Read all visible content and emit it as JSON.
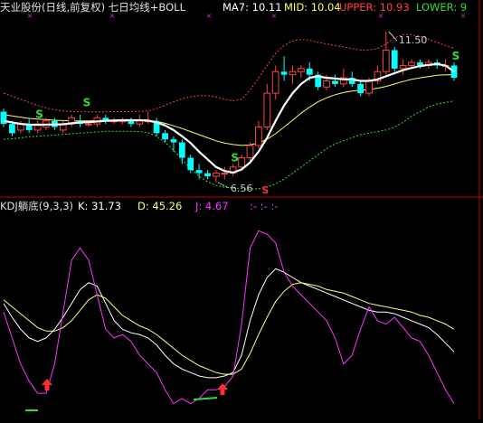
{
  "main_header": {
    "title": "天业股份(日线,前复权) 七日均线+BOLL",
    "ma7": "MA7: 10.11",
    "mid": "MID: 10.04",
    "upper": "UPPER: 10.93",
    "lower": "LOWER: 9"
  },
  "kdj_header": {
    "title": "KDJ躺底(9,3,3)",
    "k": "K: 31.73",
    "d": "D: 45.26",
    "j": "J: 4.67",
    "extra": ":- :- :-"
  },
  "colors": {
    "background": "#000000",
    "title": "#e0e0e0",
    "ma7": "#ffffff",
    "mid": "#ffff66",
    "upper": "#ff4040",
    "lower": "#33dd33",
    "k_line": "#ffffff",
    "d_line": "#ffff80",
    "j_line": "#ff33ff",
    "candle_up": "#ff4040",
    "candle_down": "#00ffff",
    "divider": "#c00000"
  },
  "chart_data": [
    {
      "type": "candlestick",
      "title": "天业股份(日线,前复权) 七日均线+BOLL",
      "price_range": [
        6.3,
        12.0
      ],
      "annotations": {
        "high_label": "11.50",
        "low_label": "6.56",
        "signal_marks": [
          "S",
          "S",
          "S",
          "S"
        ],
        "bottom_signal": "S"
      },
      "candles": [
        [
          8.9,
          8.5,
          9.0,
          8.4
        ],
        [
          8.5,
          8.2,
          8.6,
          8.1
        ],
        [
          8.3,
          8.5,
          8.6,
          8.2
        ],
        [
          8.5,
          8.3,
          8.7,
          8.2
        ],
        [
          8.3,
          8.5,
          8.6,
          8.2
        ],
        [
          8.4,
          8.6,
          8.7,
          8.3
        ],
        [
          8.6,
          8.4,
          8.7,
          8.3
        ],
        [
          8.3,
          8.5,
          8.6,
          8.2
        ],
        [
          8.5,
          8.7,
          8.8,
          8.4
        ],
        [
          8.6,
          8.5,
          8.8,
          8.4
        ],
        [
          8.5,
          8.5,
          8.6,
          8.4
        ],
        [
          8.5,
          8.7,
          8.8,
          8.4
        ],
        [
          8.7,
          8.6,
          8.8,
          8.5
        ],
        [
          8.6,
          8.6,
          8.7,
          8.5
        ],
        [
          8.6,
          8.6,
          8.7,
          8.5
        ],
        [
          8.6,
          8.5,
          8.7,
          8.4
        ],
        [
          8.5,
          8.6,
          8.8,
          8.4
        ],
        [
          8.6,
          8.6,
          8.9,
          8.5
        ],
        [
          8.6,
          8.2,
          8.7,
          8.1
        ],
        [
          8.2,
          8.0,
          8.3,
          7.9
        ],
        [
          8.0,
          7.9,
          8.1,
          7.6
        ],
        [
          7.9,
          7.4,
          8.0,
          7.2
        ],
        [
          7.4,
          7.0,
          7.5,
          6.9
        ],
        [
          7.0,
          6.9,
          7.2,
          6.7
        ],
        [
          6.9,
          6.8,
          7.0,
          6.7
        ],
        [
          6.8,
          6.9,
          7.0,
          6.6
        ],
        [
          6.9,
          6.9,
          7.1,
          6.7
        ],
        [
          6.9,
          7.1,
          7.2,
          6.8
        ],
        [
          7.1,
          7.4,
          7.5,
          7.0
        ],
        [
          7.4,
          7.8,
          7.9,
          7.3
        ],
        [
          7.8,
          8.4,
          8.6,
          7.7
        ],
        [
          8.4,
          9.5,
          9.8,
          8.3
        ],
        [
          9.5,
          10.2,
          10.4,
          9.3
        ],
        [
          10.2,
          10.1,
          10.7,
          9.9
        ],
        [
          10.1,
          10.2,
          10.4,
          9.8
        ],
        [
          10.2,
          10.3,
          10.4,
          10.0
        ],
        [
          10.3,
          10.1,
          10.5,
          9.9
        ],
        [
          10.1,
          9.7,
          10.2,
          9.6
        ],
        [
          9.7,
          9.9,
          10.1,
          9.6
        ],
        [
          9.9,
          9.8,
          10.1,
          9.7
        ],
        [
          9.8,
          10.0,
          10.3,
          9.7
        ],
        [
          10.0,
          9.8,
          10.2,
          9.7
        ],
        [
          9.8,
          9.5,
          9.9,
          9.4
        ],
        [
          9.5,
          9.9,
          10.0,
          9.4
        ],
        [
          9.9,
          10.2,
          10.4,
          9.8
        ],
        [
          10.2,
          10.9,
          11.5,
          10.1
        ],
        [
          10.9,
          10.3,
          11.0,
          10.2
        ],
        [
          10.3,
          10.4,
          10.6,
          10.1
        ],
        [
          10.4,
          10.5,
          10.6,
          10.3
        ],
        [
          10.5,
          10.4,
          10.6,
          10.3
        ],
        [
          10.4,
          10.5,
          10.6,
          10.3
        ],
        [
          10.5,
          10.4,
          10.6,
          10.3
        ],
        [
          10.4,
          10.4,
          10.6,
          10.2
        ],
        [
          10.4,
          10.0,
          10.5,
          9.9
        ]
      ],
      "ma7": [
        8.6,
        8.55,
        8.5,
        8.48,
        8.47,
        8.48,
        8.48,
        8.49,
        8.52,
        8.55,
        8.56,
        8.58,
        8.6,
        8.61,
        8.62,
        8.62,
        8.62,
        8.61,
        8.55,
        8.45,
        8.3,
        8.1,
        7.88,
        7.6,
        7.35,
        7.1,
        6.97,
        6.92,
        7.02,
        7.25,
        7.6,
        8.05,
        8.6,
        9.1,
        9.5,
        9.8,
        10.0,
        10.05,
        10.0,
        9.98,
        9.95,
        9.95,
        9.9,
        9.9,
        9.95,
        10.05,
        10.15,
        10.25,
        10.32,
        10.38,
        10.42,
        10.45,
        10.4,
        10.2
      ],
      "mid": [
        8.8,
        8.76,
        8.72,
        8.68,
        8.66,
        8.64,
        8.62,
        8.61,
        8.6,
        8.6,
        8.6,
        8.61,
        8.62,
        8.63,
        8.63,
        8.63,
        8.63,
        8.62,
        8.58,
        8.52,
        8.44,
        8.35,
        8.25,
        8.15,
        8.05,
        7.95,
        7.88,
        7.83,
        7.8,
        7.82,
        7.88,
        8.0,
        8.18,
        8.4,
        8.62,
        8.85,
        9.05,
        9.22,
        9.35,
        9.45,
        9.52,
        9.57,
        9.6,
        9.62,
        9.66,
        9.72,
        9.8,
        9.88,
        9.95,
        10.0,
        10.04,
        10.08,
        10.1,
        10.1
      ],
      "upper": [
        9.5,
        9.4,
        9.3,
        9.2,
        9.1,
        9.02,
        8.96,
        8.92,
        8.9,
        8.89,
        8.89,
        8.89,
        8.89,
        8.9,
        8.9,
        8.9,
        8.91,
        8.92,
        9.0,
        9.1,
        9.22,
        9.32,
        9.38,
        9.42,
        9.42,
        9.38,
        9.3,
        9.25,
        9.3,
        9.6,
        10.0,
        10.4,
        10.8,
        11.05,
        11.2,
        11.25,
        11.22,
        11.15,
        11.1,
        11.05,
        11.0,
        10.95,
        10.9,
        10.9,
        10.95,
        11.1,
        11.3,
        11.4,
        11.4,
        11.35,
        11.25,
        11.15,
        11.05,
        10.95
      ],
      "lower": [
        8.0,
        8.02,
        8.05,
        8.08,
        8.1,
        8.12,
        8.14,
        8.16,
        8.18,
        8.2,
        8.22,
        8.24,
        8.26,
        8.26,
        8.26,
        8.26,
        8.25,
        8.22,
        8.1,
        7.9,
        7.65,
        7.35,
        7.05,
        6.8,
        6.62,
        6.5,
        6.44,
        6.42,
        6.4,
        6.38,
        6.4,
        6.45,
        6.55,
        6.7,
        6.9,
        7.1,
        7.3,
        7.5,
        7.7,
        7.85,
        7.95,
        8.05,
        8.15,
        8.2,
        8.25,
        8.3,
        8.4,
        8.55,
        8.75,
        8.9,
        9.05,
        9.15,
        9.2,
        9.25
      ]
    },
    {
      "type": "line",
      "title": "KDJ躺底(9,3,3)",
      "ylim": [
        -5,
        110
      ],
      "series": [
        {
          "name": "K",
          "values": [
            60,
            52,
            45,
            40,
            38,
            40,
            45,
            52,
            60,
            68,
            72,
            70,
            60,
            50,
            45,
            43,
            42,
            40,
            36,
            30,
            25,
            22,
            20,
            18,
            17,
            17,
            18,
            20,
            30,
            50,
            65,
            75,
            80,
            78,
            75,
            72,
            70,
            68,
            66,
            64,
            62,
            60,
            58,
            56,
            55,
            55,
            54,
            52,
            50,
            48,
            46,
            42,
            37,
            32
          ]
        },
        {
          "name": "D",
          "values": [
            62,
            58,
            54,
            50,
            46,
            44,
            44,
            46,
            50,
            56,
            62,
            65,
            63,
            58,
            53,
            50,
            47,
            45,
            42,
            38,
            34,
            30,
            27,
            24,
            22,
            20,
            19,
            19,
            22,
            31,
            42,
            52,
            61,
            67,
            71,
            72,
            71,
            70,
            68,
            67,
            66,
            64,
            62,
            60,
            59,
            58,
            57,
            56,
            55,
            53,
            52,
            50,
            48,
            45
          ]
        },
        {
          "name": "J",
          "values": [
            55,
            40,
            25,
            15,
            8,
            8,
            25,
            55,
            85,
            92,
            85,
            65,
            45,
            40,
            42,
            38,
            30,
            25,
            20,
            10,
            2,
            5,
            2,
            5,
            10,
            10,
            12,
            18,
            48,
            92,
            102,
            100,
            95,
            78,
            70,
            65,
            60,
            55,
            50,
            40,
            25,
            30,
            45,
            58,
            50,
            48,
            52,
            46,
            40,
            38,
            30,
            20,
            10,
            2
          ]
        }
      ],
      "arrows": 2
    }
  ]
}
